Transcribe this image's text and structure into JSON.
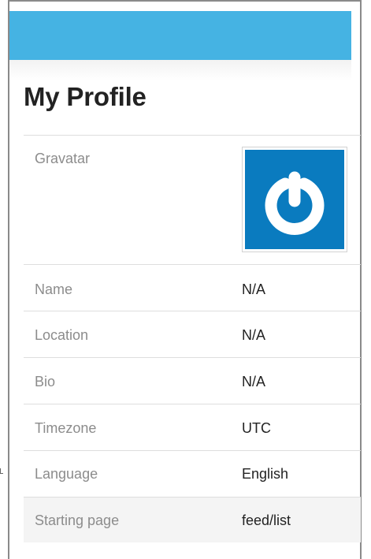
{
  "page": {
    "title": "My Profile"
  },
  "colors": {
    "header_bar": "#45b3e3",
    "gravatar_bg": "#0a7bbf",
    "label_text": "#8c8c8c",
    "value_text": "#222222"
  },
  "profile": {
    "gravatar": {
      "label": "Gravatar",
      "icon": "gravatar-power-logo-icon"
    },
    "rows": [
      {
        "label": "Name",
        "value": "N/A"
      },
      {
        "label": "Location",
        "value": "N/A"
      },
      {
        "label": "Bio",
        "value": "N/A"
      },
      {
        "label": "Timezone",
        "value": "UTC"
      },
      {
        "label": "Language",
        "value": "English"
      },
      {
        "label": "Starting page",
        "value": "feed/list"
      }
    ]
  }
}
